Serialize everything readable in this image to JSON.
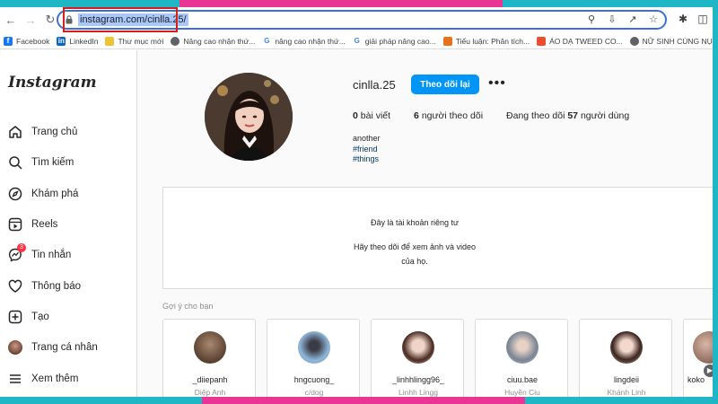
{
  "browser": {
    "url": "instagram.com/cinlla.25/",
    "bookmarks": [
      {
        "label": "Facebook",
        "icon": "facebook-icon",
        "color": "#1877f2"
      },
      {
        "label": "LinkedIn",
        "icon": "linkedin-icon",
        "color": "#0a66c2"
      },
      {
        "label": "Thư mục mới",
        "icon": "folder-icon",
        "color": "#f1c232"
      },
      {
        "label": "Nâng cao nhận thứ...",
        "icon": "globe-icon",
        "color": "#5f6368"
      },
      {
        "label": "nâng cao nhận thứ...",
        "icon": "google-icon",
        "color": "#4285f4"
      },
      {
        "label": "giải pháp nâng cao...",
        "icon": "google-icon",
        "color": "#4285f4"
      },
      {
        "label": "Tiểu luận: Phân tích...",
        "icon": "doc-icon",
        "color": "#e8711a"
      },
      {
        "label": "ÁO DẠ TWEED CO...",
        "icon": "shop-icon",
        "color": "#ee4d2d"
      },
      {
        "label": "NỮ SINH CÙNG NỤ...",
        "icon": "globe-icon",
        "color": "#5f6368"
      }
    ]
  },
  "sidebar": {
    "logo": "Instagram",
    "items": [
      {
        "label": "Trang chủ",
        "icon": "home-icon"
      },
      {
        "label": "Tìm kiếm",
        "icon": "search-icon"
      },
      {
        "label": "Khám phá",
        "icon": "compass-icon"
      },
      {
        "label": "Reels",
        "icon": "reels-icon"
      },
      {
        "label": "Tin nhắn",
        "icon": "messenger-icon",
        "badge": "3"
      },
      {
        "label": "Thông báo",
        "icon": "heart-icon"
      },
      {
        "label": "Tạo",
        "icon": "create-icon"
      },
      {
        "label": "Trang cá nhân",
        "icon": "avatar"
      },
      {
        "label": "Xem thêm",
        "icon": "menu-icon"
      }
    ]
  },
  "profile": {
    "username": "cinlla.25",
    "follow_label": "Theo dõi lại",
    "more_label": "•••",
    "posts_count": "0",
    "posts_label": "bài viết",
    "followers_count": "6",
    "followers_label": "người theo dõi",
    "following_prefix": "Đang theo dõi",
    "following_count": "57",
    "following_suffix": "người dùng",
    "bio": [
      "another",
      "#friend",
      "#things"
    ]
  },
  "private_notice": {
    "title": "Đây là tài khoản riêng tư",
    "subtitle_line1": "Hãy theo dõi để xem ảnh và video",
    "subtitle_line2": "của họ."
  },
  "suggestions": {
    "title": "Gợi ý cho bạn",
    "cards": [
      {
        "username": "_diiepanh",
        "name": "Diệp Anh",
        "color": "#5a4030"
      },
      {
        "username": "hngcuong_",
        "name": "c/dog",
        "color": "#6f9bc4"
      },
      {
        "username": "_linhhlingg96_",
        "name": "Linhh Lingg",
        "color": "#d8b7ad"
      },
      {
        "username": "ciuu.bae",
        "name": "Huyền Ciu",
        "color": "#b9c3cf"
      },
      {
        "username": "lingdeii",
        "name": "Khánh Linh",
        "color": "#c7a59a"
      }
    ],
    "partial_username": "koko"
  }
}
